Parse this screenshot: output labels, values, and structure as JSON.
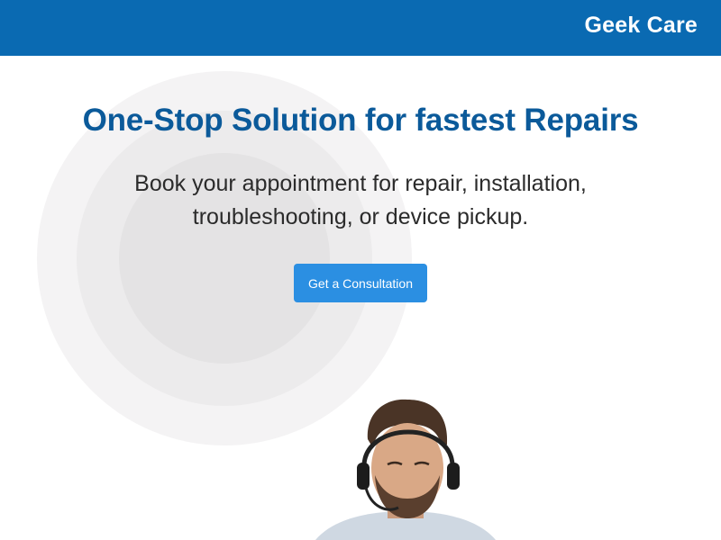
{
  "header": {
    "brand": "Geek Care"
  },
  "hero": {
    "headline": "One-Stop Solution for fastest Repairs",
    "subtext_line1": "Book your appointment for repair, installation,",
    "subtext_line2": "troubleshooting, or device pickup.",
    "cta_label": "Get a Consultation"
  },
  "colors": {
    "header_bg": "#0a6ab2",
    "headline": "#0b5a9a",
    "cta_bg": "#2b8fe2"
  },
  "icons": [
    "support-agent-image"
  ]
}
